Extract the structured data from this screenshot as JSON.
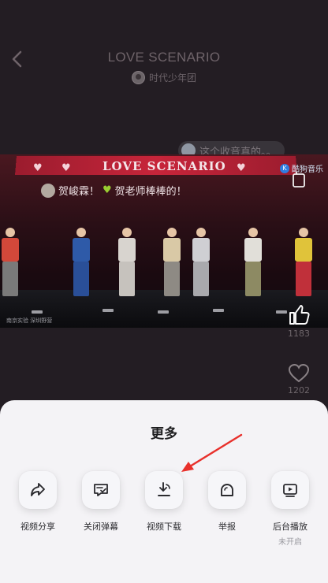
{
  "header": {
    "title": "LOVE SCENARIO",
    "artist": "时代少年团"
  },
  "danmaku": {
    "bubble_text": "这个收音真的。。"
  },
  "video": {
    "banner_text": "LOVE SCENARIO",
    "watermark": "酷狗音乐",
    "comment_prefix": "贺峻霖！",
    "comment_suffix": "贺老师棒棒的！",
    "caption": "南京实验  深圳野营"
  },
  "side": {
    "like_count": "1183",
    "favorite_count": "1202"
  },
  "sheet": {
    "title": "更多",
    "options": [
      {
        "label": "视频分享",
        "icon": "share-icon"
      },
      {
        "label": "关闭弹幕",
        "icon": "danmaku-off-icon"
      },
      {
        "label": "视频下载",
        "icon": "download-icon"
      },
      {
        "label": "举报",
        "icon": "report-icon"
      },
      {
        "label": "后台播放",
        "sub": "未开启",
        "icon": "background-play-icon"
      }
    ]
  },
  "colors": {
    "background": "#231d23",
    "sheet": "#f4f3f6",
    "arrow": "#e8302b",
    "banner": "#c7253a"
  }
}
